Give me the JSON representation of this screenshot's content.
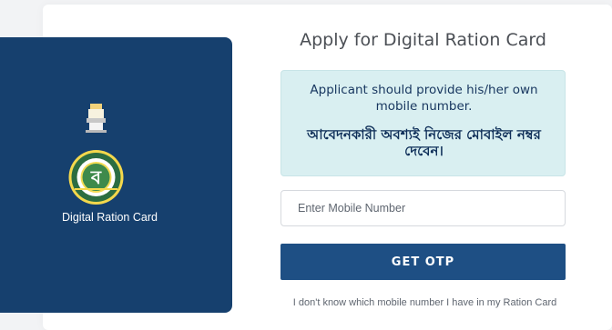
{
  "left_panel": {
    "title": "Digital Ration Card"
  },
  "right_panel": {
    "title": "Apply for Digital Ration Card",
    "notice": {
      "english": "Applicant should provide his/her own mobile number.",
      "bengali": "আবেদনকারী অবশ্যই নিজের মোবাইল নম্বর দেবেন।"
    },
    "mobile_input": {
      "placeholder": "Enter Mobile Number",
      "value": ""
    },
    "button_label": "GET OTP",
    "help_link": "I don't know which mobile number I have in my Ration Card"
  },
  "colors": {
    "primary": "#1e4f84",
    "left_panel_bg": "#16406e",
    "notice_bg": "#d9eff1"
  },
  "icons": {
    "emblem": "state-emblem-icon"
  }
}
